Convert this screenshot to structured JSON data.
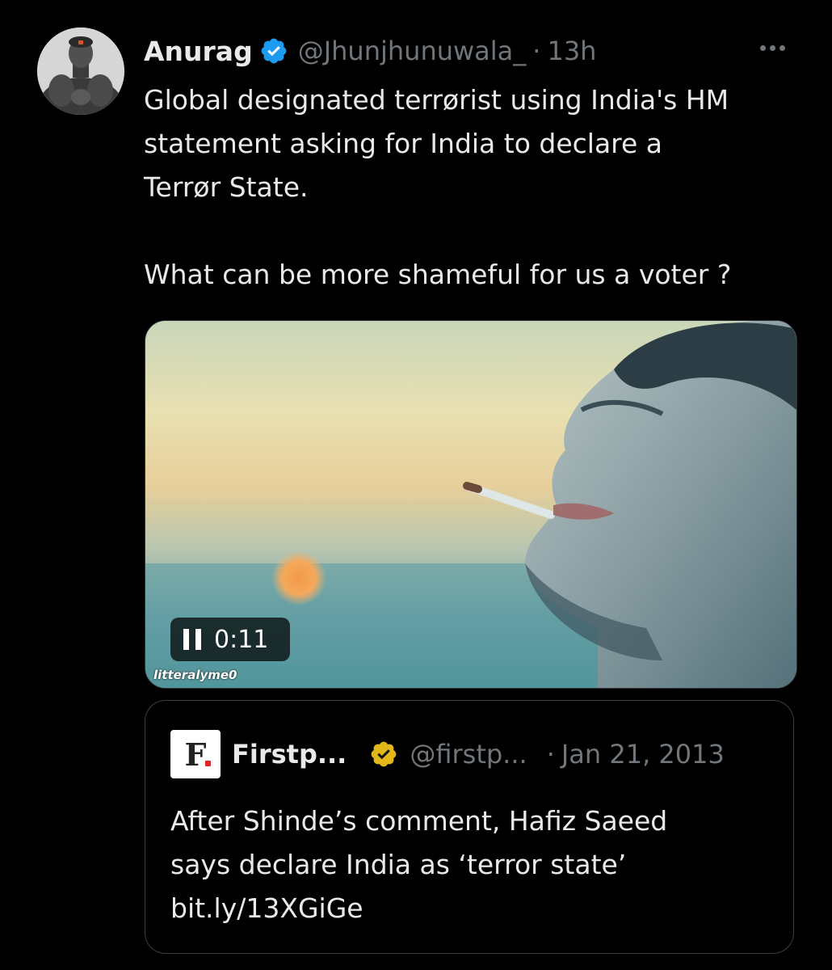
{
  "tweet": {
    "author_name": "Anurag",
    "author_handle": "@Jhunjhunuwala_",
    "separator": "·",
    "time": "13h",
    "text_line1": "Global designated terrørist using India's HM",
    "text_line2": "statement asking for India to declare a",
    "text_line3": "Terrør State.",
    "text_line4": "What can be more shameful for us a voter ?",
    "verified_icon": "verified-badge-icon",
    "more_icon": "more-options-icon"
  },
  "media": {
    "duration": "0:11",
    "watermark": "litteralyme0",
    "state_icon": "pause-icon"
  },
  "quote": {
    "logo_letter": "F",
    "author_name": "Firstp...",
    "author_handle": "@firstp...",
    "separator": "·",
    "date": "Jan 21, 2013",
    "text_line1": "After Shinde’s comment, Hafiz Saeed",
    "text_line2": "says declare India as ‘terror state’",
    "text_line3": "bit.ly/13XGiGe",
    "verified_icon": "gold-verified-badge-icon"
  },
  "colors": {
    "background": "#000000",
    "primary_text": "#e7e9ea",
    "secondary_text": "#71767b",
    "verified_blue": "#1d9bf0",
    "verified_gold": "#e2b719",
    "border": "#2f3336"
  }
}
